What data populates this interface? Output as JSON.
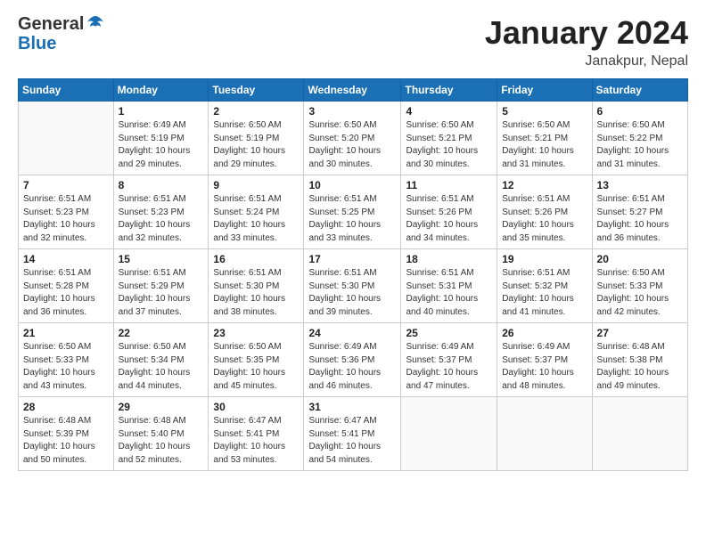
{
  "header": {
    "logo_general": "General",
    "logo_blue": "Blue",
    "title": "January 2024",
    "location": "Janakpur, Nepal"
  },
  "weekdays": [
    "Sunday",
    "Monday",
    "Tuesday",
    "Wednesday",
    "Thursday",
    "Friday",
    "Saturday"
  ],
  "weeks": [
    [
      {
        "day": "",
        "info": ""
      },
      {
        "day": "1",
        "info": "Sunrise: 6:49 AM\nSunset: 5:19 PM\nDaylight: 10 hours\nand 29 minutes."
      },
      {
        "day": "2",
        "info": "Sunrise: 6:50 AM\nSunset: 5:19 PM\nDaylight: 10 hours\nand 29 minutes."
      },
      {
        "day": "3",
        "info": "Sunrise: 6:50 AM\nSunset: 5:20 PM\nDaylight: 10 hours\nand 30 minutes."
      },
      {
        "day": "4",
        "info": "Sunrise: 6:50 AM\nSunset: 5:21 PM\nDaylight: 10 hours\nand 30 minutes."
      },
      {
        "day": "5",
        "info": "Sunrise: 6:50 AM\nSunset: 5:21 PM\nDaylight: 10 hours\nand 31 minutes."
      },
      {
        "day": "6",
        "info": "Sunrise: 6:50 AM\nSunset: 5:22 PM\nDaylight: 10 hours\nand 31 minutes."
      }
    ],
    [
      {
        "day": "7",
        "info": "Sunrise: 6:51 AM\nSunset: 5:23 PM\nDaylight: 10 hours\nand 32 minutes."
      },
      {
        "day": "8",
        "info": "Sunrise: 6:51 AM\nSunset: 5:23 PM\nDaylight: 10 hours\nand 32 minutes."
      },
      {
        "day": "9",
        "info": "Sunrise: 6:51 AM\nSunset: 5:24 PM\nDaylight: 10 hours\nand 33 minutes."
      },
      {
        "day": "10",
        "info": "Sunrise: 6:51 AM\nSunset: 5:25 PM\nDaylight: 10 hours\nand 33 minutes."
      },
      {
        "day": "11",
        "info": "Sunrise: 6:51 AM\nSunset: 5:26 PM\nDaylight: 10 hours\nand 34 minutes."
      },
      {
        "day": "12",
        "info": "Sunrise: 6:51 AM\nSunset: 5:26 PM\nDaylight: 10 hours\nand 35 minutes."
      },
      {
        "day": "13",
        "info": "Sunrise: 6:51 AM\nSunset: 5:27 PM\nDaylight: 10 hours\nand 36 minutes."
      }
    ],
    [
      {
        "day": "14",
        "info": "Sunrise: 6:51 AM\nSunset: 5:28 PM\nDaylight: 10 hours\nand 36 minutes."
      },
      {
        "day": "15",
        "info": "Sunrise: 6:51 AM\nSunset: 5:29 PM\nDaylight: 10 hours\nand 37 minutes."
      },
      {
        "day": "16",
        "info": "Sunrise: 6:51 AM\nSunset: 5:30 PM\nDaylight: 10 hours\nand 38 minutes."
      },
      {
        "day": "17",
        "info": "Sunrise: 6:51 AM\nSunset: 5:30 PM\nDaylight: 10 hours\nand 39 minutes."
      },
      {
        "day": "18",
        "info": "Sunrise: 6:51 AM\nSunset: 5:31 PM\nDaylight: 10 hours\nand 40 minutes."
      },
      {
        "day": "19",
        "info": "Sunrise: 6:51 AM\nSunset: 5:32 PM\nDaylight: 10 hours\nand 41 minutes."
      },
      {
        "day": "20",
        "info": "Sunrise: 6:50 AM\nSunset: 5:33 PM\nDaylight: 10 hours\nand 42 minutes."
      }
    ],
    [
      {
        "day": "21",
        "info": "Sunrise: 6:50 AM\nSunset: 5:33 PM\nDaylight: 10 hours\nand 43 minutes."
      },
      {
        "day": "22",
        "info": "Sunrise: 6:50 AM\nSunset: 5:34 PM\nDaylight: 10 hours\nand 44 minutes."
      },
      {
        "day": "23",
        "info": "Sunrise: 6:50 AM\nSunset: 5:35 PM\nDaylight: 10 hours\nand 45 minutes."
      },
      {
        "day": "24",
        "info": "Sunrise: 6:49 AM\nSunset: 5:36 PM\nDaylight: 10 hours\nand 46 minutes."
      },
      {
        "day": "25",
        "info": "Sunrise: 6:49 AM\nSunset: 5:37 PM\nDaylight: 10 hours\nand 47 minutes."
      },
      {
        "day": "26",
        "info": "Sunrise: 6:49 AM\nSunset: 5:37 PM\nDaylight: 10 hours\nand 48 minutes."
      },
      {
        "day": "27",
        "info": "Sunrise: 6:48 AM\nSunset: 5:38 PM\nDaylight: 10 hours\nand 49 minutes."
      }
    ],
    [
      {
        "day": "28",
        "info": "Sunrise: 6:48 AM\nSunset: 5:39 PM\nDaylight: 10 hours\nand 50 minutes."
      },
      {
        "day": "29",
        "info": "Sunrise: 6:48 AM\nSunset: 5:40 PM\nDaylight: 10 hours\nand 52 minutes."
      },
      {
        "day": "30",
        "info": "Sunrise: 6:47 AM\nSunset: 5:41 PM\nDaylight: 10 hours\nand 53 minutes."
      },
      {
        "day": "31",
        "info": "Sunrise: 6:47 AM\nSunset: 5:41 PM\nDaylight: 10 hours\nand 54 minutes."
      },
      {
        "day": "",
        "info": ""
      },
      {
        "day": "",
        "info": ""
      },
      {
        "day": "",
        "info": ""
      }
    ]
  ]
}
